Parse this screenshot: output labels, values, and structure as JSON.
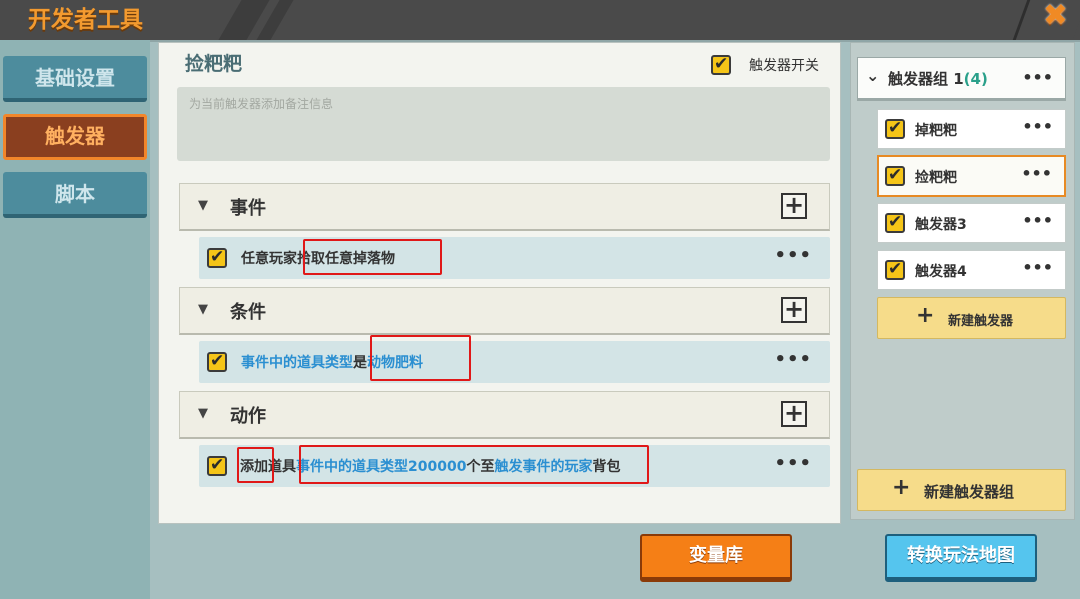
{
  "header": {
    "title": "开发者工具",
    "close_icon": "close-icon",
    "accent": "#f39a2f"
  },
  "nav": {
    "items": [
      {
        "label": "基础设置",
        "active": false
      },
      {
        "label": "触发器",
        "active": true
      },
      {
        "label": "脚本",
        "active": false
      }
    ]
  },
  "trigger": {
    "name": "捡粑粑",
    "switch_label": "触发器开关",
    "switch_on": true,
    "note_placeholder": "为当前触发器添加备注信息"
  },
  "sections": {
    "event": {
      "label": "事件",
      "row": {
        "part1": "任意玩家",
        "part2": "拾取任意掉落物"
      }
    },
    "condition": {
      "label": "条件",
      "row": {
        "part1": "事件中的道具类型",
        "part2": "是",
        "part3": "动物肥料"
      }
    },
    "action": {
      "label": "动作",
      "row": {
        "part1": "添加",
        "part2": "道具",
        "part3": "事件中的道具类型",
        "part4": "200000",
        "part5": "个至",
        "part6": "触发事件的玩家",
        "part7": "背包"
      }
    }
  },
  "buttons": {
    "variables": "变量库",
    "convert_map": "转换玩法地图"
  },
  "sidebar": {
    "group": {
      "label": "触发器组 1",
      "count": "(4)"
    },
    "triggers": [
      {
        "label": "掉粑粑",
        "checked": true,
        "selected": false
      },
      {
        "label": "捡粑粑",
        "checked": true,
        "selected": true
      },
      {
        "label": "触发器3",
        "checked": true,
        "selected": false
      },
      {
        "label": "触发器4",
        "checked": true,
        "selected": false
      }
    ],
    "new_trigger": "新建触发器",
    "new_group": "新建触发器组"
  },
  "icons": {
    "more": "more-dots-icon",
    "add": "plus-icon",
    "expand": "triangle-down-icon",
    "check": "checkbox-checked-icon"
  },
  "colors": {
    "checkbox": "#f5c518",
    "highlight_blue": "#2b8fd1",
    "orange_button": "#f57f16",
    "blue_button": "#55c5ee",
    "annotation_red": "#e01818"
  }
}
